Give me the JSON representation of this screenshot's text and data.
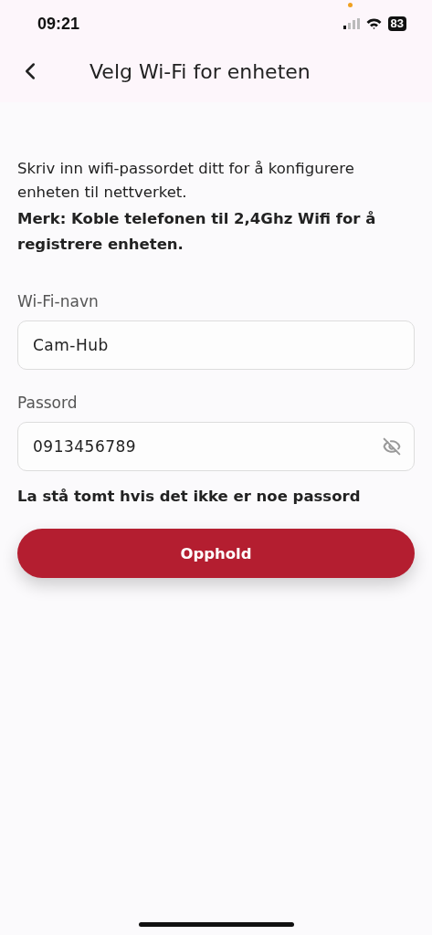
{
  "status_bar": {
    "time": "09:21",
    "battery": "83"
  },
  "header": {
    "title": "Velg Wi-Fi for enheten"
  },
  "intro": "Skriv inn wifi-passordet ditt for å konfigurere enheten til nettverket.",
  "note": "Merk: Koble telefonen til 2,4Ghz Wifi for å registrere enheten.",
  "fields": [
    {
      "kind": "text",
      "label": "Wi-Fi-navn",
      "value": "Cam-Hub"
    },
    {
      "kind": "password",
      "label": "Passord",
      "value": "0913456789",
      "visible": true
    }
  ],
  "hint": "La stå tomt hvis det ikke er noe passord",
  "button": "Opphold"
}
